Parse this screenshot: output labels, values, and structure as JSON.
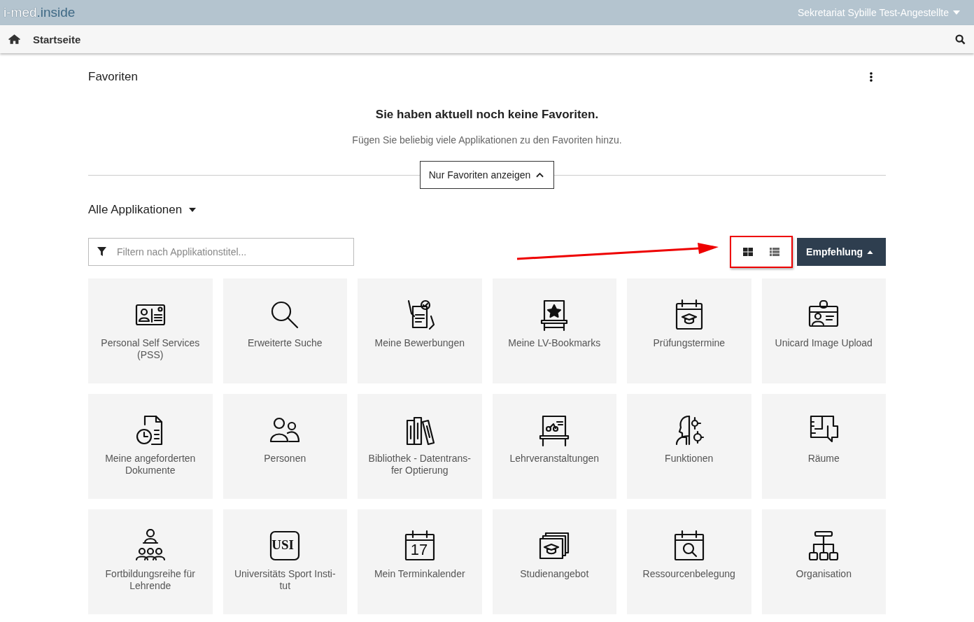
{
  "header": {
    "logo_part_1": "i-med",
    "logo_part_2": ".inside",
    "user": "Sekretariat Sybille Test-Angestellte"
  },
  "navbar": {
    "title": "Startseite"
  },
  "favorites": {
    "title": "Favoriten",
    "empty_title": "Sie haben aktuell noch keine Favoriten.",
    "empty_text": "Fügen Sie beliebig viele Applikationen zu den Favoriten hinzu.",
    "toggle_button": "Nur Favoriten anzeigen"
  },
  "apps": {
    "title": "Alle Applikationen",
    "filter": {
      "placeholder": "Filtern nach Applikationstitel..."
    },
    "views": [
      {
        "kind": "grid",
        "selected": true
      },
      {
        "kind": "list",
        "selected": false
      }
    ],
    "sort_button": "Empfehlung",
    "tiles": [
      {
        "lines": [
          "Personal Self Services",
          "(PSS)"
        ]
      },
      {
        "lines": [
          "Erweiterte Suche"
        ]
      },
      {
        "lines": [
          "Meine Bewerbungen"
        ]
      },
      {
        "lines": [
          "Meine LV-Bookmarks"
        ]
      },
      {
        "lines": [
          "Prüfungstermine"
        ]
      },
      {
        "lines": [
          "Unicard Image Upload"
        ]
      },
      {
        "lines": [
          "Meine angeforderten",
          "Dokumente"
        ]
      },
      {
        "lines": [
          "Personen"
        ]
      },
      {
        "lines": [
          "Bibliothek - Datentrans-",
          "fer Optierung"
        ]
      },
      {
        "lines": [
          "Lehrveranstaltungen"
        ]
      },
      {
        "lines": [
          "Funktionen"
        ]
      },
      {
        "lines": [
          "Räume"
        ]
      },
      {
        "lines": [
          "Fortbildungsreihe für",
          "Lehrende"
        ]
      },
      {
        "lines": [
          "Universitäts Sport Insti-",
          "tut"
        ],
        "badge": "USI"
      },
      {
        "lines": [
          "Mein Terminkalender"
        ],
        "badge": "17"
      },
      {
        "lines": [
          "Studienangebot"
        ]
      },
      {
        "lines": [
          "Ressourcenbelegung"
        ]
      },
      {
        "lines": [
          "Organisation"
        ]
      }
    ]
  }
}
